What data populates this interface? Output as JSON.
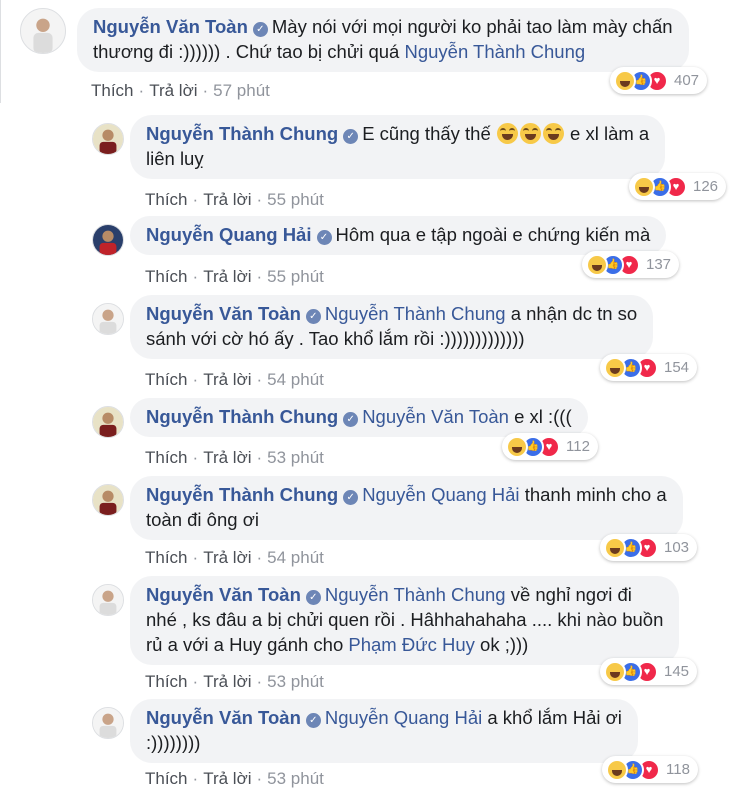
{
  "labels": {
    "like": "Thích",
    "reply": "Trả lời"
  },
  "comments": [
    {
      "author": "Nguyễn Văn Toàn",
      "line1": "Mày nói với mọi người ko phải tao làm mày chấn",
      "line2_a": "thương đi :)))))) . Chứ tao bị chửi quá",
      "mention": "Nguyễn Thành Chung",
      "time": "57 phút",
      "reactions": "407"
    },
    {
      "author": "Nguyễn Thành Chung",
      "line1_a": "E cũng thấy thế",
      "line1_b": "e xl làm a",
      "line2": "liên luỵ",
      "time": "55 phút",
      "reactions": "126"
    },
    {
      "author": "Nguyễn Quang Hải",
      "line1": "Hôm qua e tập ngoài e chứng kiến mà",
      "time": "55 phút",
      "reactions": "137"
    },
    {
      "author": "Nguyễn Văn Toàn",
      "mention": "Nguyễn Thành Chung",
      "line1": "a nhận dc tn so",
      "line2": "sánh với cờ hó ấy . Tao khổ lắm rồi :)))))))))))))",
      "time": "54 phút",
      "reactions": "154"
    },
    {
      "author": "Nguyễn Thành Chung",
      "mention": "Nguyễn Văn Toàn",
      "line1": "e xl :(((",
      "time": "53 phút",
      "reactions": "112"
    },
    {
      "author": "Nguyễn Thành Chung",
      "mention": "Nguyễn Quang Hải",
      "line1": "thanh minh cho a",
      "line2": "toàn đi ông ơi",
      "time": "54 phút",
      "reactions": "103"
    },
    {
      "author": "Nguyễn Văn Toàn",
      "mention": "Nguyễn Thành Chung",
      "line1": "về nghỉ ngơi đi",
      "line2": "nhé , ks đâu a bị chửi quen rồi . Hâhhahahaha .... khi nào buồn",
      "line3_a": "rủ a với a Huy gánh cho",
      "mention2": "Phạm Đức Huy",
      "line3_b": "ok ;)))",
      "time": "53 phút",
      "reactions": "145"
    },
    {
      "author": "Nguyễn Văn Toàn",
      "mention": "Nguyễn Quang Hải",
      "line1": "a khổ lắm Hải ơi",
      "line2": ":))))))))",
      "time": "53 phút",
      "reactions": "118"
    }
  ],
  "colors": {
    "link": "#385898",
    "bubble": "#f2f3f5",
    "meta": "#90949c"
  },
  "icons": [
    "verified-badge-icon",
    "haha-reaction-icon",
    "like-reaction-icon",
    "love-reaction-icon",
    "grinning-sweat-emoji"
  ]
}
